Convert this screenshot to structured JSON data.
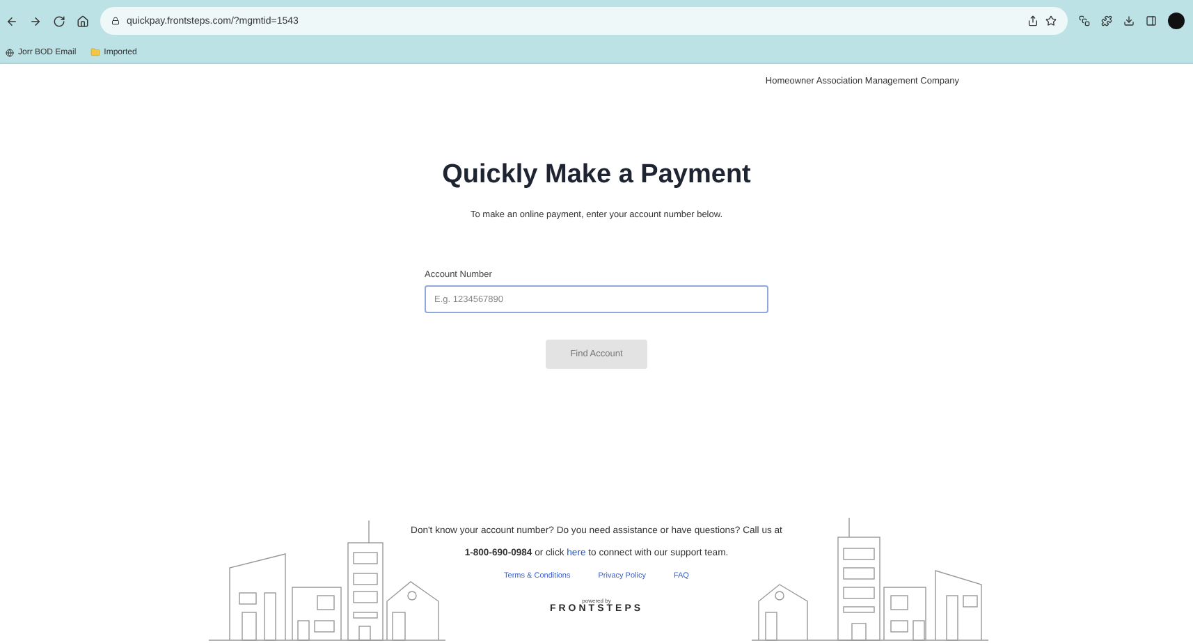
{
  "browser": {
    "url": "quickpay.frontsteps.com/?mgmtid=1543",
    "bookmarks": [
      {
        "label": "Jorr BOD Email",
        "kind": "page"
      },
      {
        "label": "Imported",
        "kind": "folder"
      }
    ]
  },
  "header": {
    "company": "Homeowner Association Management Company"
  },
  "title": "Quickly Make a Payment",
  "subtitle": "To make an online payment, enter your account number below.",
  "account_field": {
    "label": "Account Number",
    "placeholder": "E.g. 1234567890"
  },
  "find_button": {
    "label": "Find Account",
    "disabled": true
  },
  "help": {
    "text": "Don't know your account number? Do you need assistance or have questions? Call us at",
    "text_2": "**1-800-690-0984** or click",
    "link": "here",
    "text_after": "to connect with our support team."
  },
  "footer_links": [
    "Terms & Conditions",
    "Privacy Policy",
    "FAQ"
  ],
  "brand": {
    "powered_by": "powered by",
    "name": "FRONTSTEPS"
  }
}
